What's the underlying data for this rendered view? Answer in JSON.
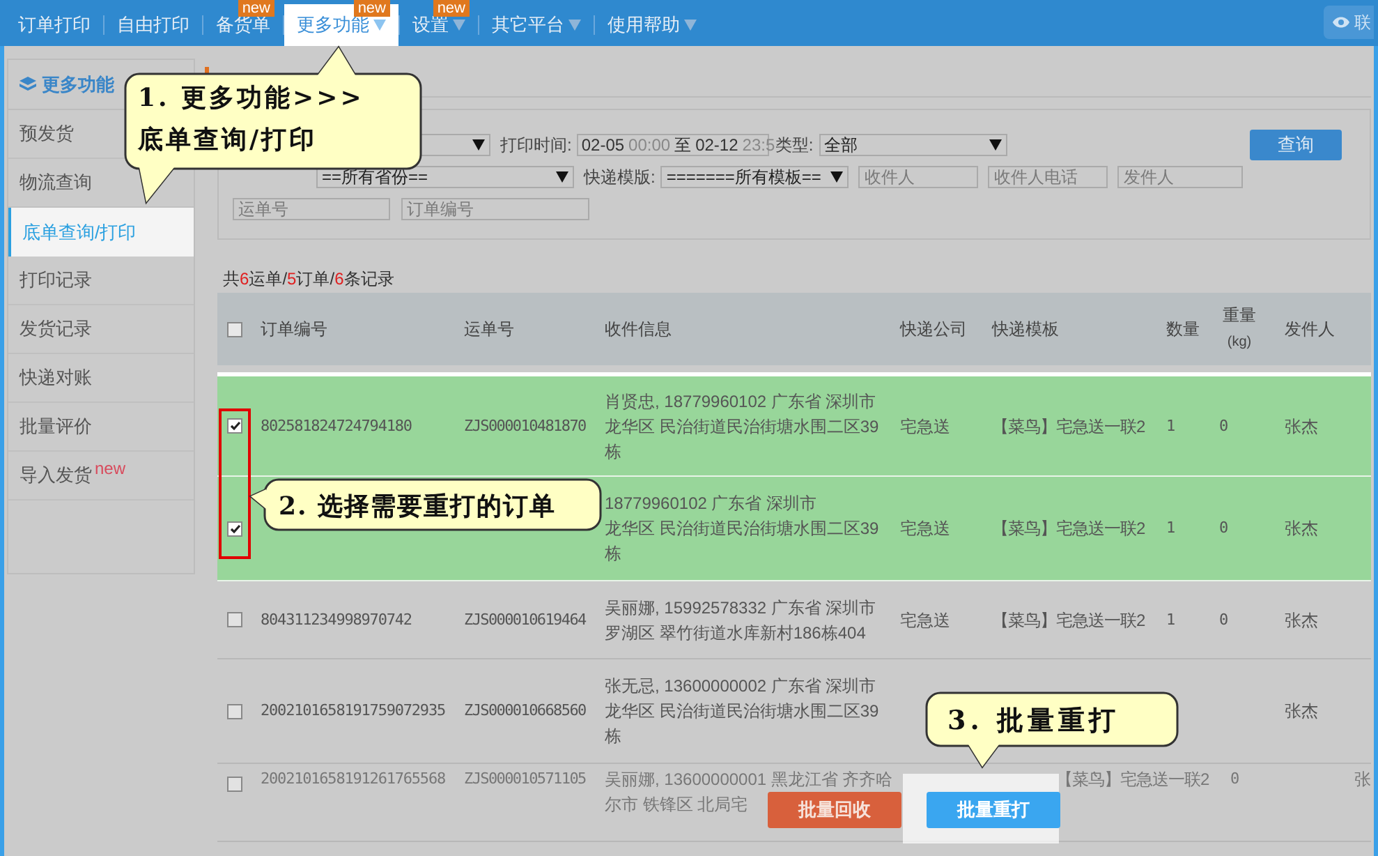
{
  "nav": {
    "tabs": [
      {
        "label": "订单打印",
        "selected": false,
        "has_menu": false
      },
      {
        "label": "自由打印",
        "selected": false,
        "has_menu": false
      },
      {
        "label": "备货单",
        "selected": false,
        "has_menu": false,
        "badge": "new"
      },
      {
        "label": "更多功能",
        "selected": true,
        "has_menu": true,
        "badge": "new"
      },
      {
        "label": "设置",
        "selected": false,
        "has_menu": true,
        "badge": "new"
      },
      {
        "label": "其它平台",
        "selected": false,
        "has_menu": true
      },
      {
        "label": "使用帮助",
        "selected": false,
        "has_menu": true
      }
    ],
    "right_button": "联"
  },
  "sidebar": {
    "title": "更多功能",
    "items": [
      {
        "label": "预发货",
        "selected": false
      },
      {
        "label": "物流查询",
        "selected": false
      },
      {
        "label": "底单查询/打印",
        "selected": true
      },
      {
        "label": "打印记录",
        "selected": false
      },
      {
        "label": "发货记录",
        "selected": false
      },
      {
        "label": "快递对账",
        "selected": false
      },
      {
        "label": "批量评价",
        "selected": false
      },
      {
        "label": "导入发货",
        "selected": false,
        "badge": "new"
      }
    ]
  },
  "filters": {
    "print_time_label": "打印时间:",
    "date_start": "02-05",
    "time_start": "00:00",
    "date_sep": "至",
    "date_end": "02-12",
    "time_end": "23:5",
    "type_label": "类型:",
    "type_value": "全部",
    "query_button": "查询",
    "province_value": "==所有省份==",
    "template_label": "快递模版:",
    "template_value": "=======所有模板==",
    "placeholders_row2": [
      "收件人",
      "收件人电话",
      "发件人"
    ],
    "placeholders_row3": [
      "运单号",
      "订单编号"
    ]
  },
  "summary": [
    {
      "text": "共",
      "highlight": false
    },
    {
      "text": "6",
      "highlight": true
    },
    {
      "text": "运单/",
      "highlight": false
    },
    {
      "text": "5",
      "highlight": true
    },
    {
      "text": "订单/",
      "highlight": false
    },
    {
      "text": "6",
      "highlight": true
    },
    {
      "text": "条记录",
      "highlight": false
    }
  ],
  "table": {
    "header_checked": false,
    "columns": [
      "订单编号",
      "运单号",
      "收件信息",
      "快递公司",
      "快递模板",
      "数量",
      "重量",
      "发件人"
    ],
    "weight_unit": "(kg)",
    "rows": [
      {
        "selected": true,
        "checked": true,
        "order": "802581824724794180",
        "waybill": "ZJS000010481870",
        "address": [
          "肖贤忠, 18779960102 广东省 深圳市",
          "龙华区 民治街道民治街塘水围二区39",
          "栋"
        ],
        "company": "宅急送",
        "template": "【菜鸟】宅急送一联2",
        "qty": "1",
        "weight": "0",
        "sender": "张杰"
      },
      {
        "selected": true,
        "checked": true,
        "address": [
          "18779960102 广东省 深圳市",
          "龙华区 民治街道民治街塘水围二区39",
          "栋"
        ],
        "company": "宅急送",
        "template": "【菜鸟】宅急送一联2",
        "qty": "1",
        "weight": "0",
        "sender": "张杰"
      },
      {
        "selected": false,
        "checked": false,
        "order": "804311234998970742",
        "waybill": "ZJS000010619464",
        "address": [
          "吴丽娜, 15992578332 广东省 深圳市",
          "罗湖区 翠竹街道水库新村186栋404"
        ],
        "company": "宅急送",
        "template": "【菜鸟】宅急送一联2",
        "qty": "1",
        "weight": "0",
        "sender": "张杰"
      },
      {
        "selected": false,
        "checked": false,
        "order": "2002101658191759072935",
        "waybill": "ZJS000010668560",
        "address": [
          "张无忌, 13600000002 广东省 深圳市",
          "龙华区 民治街道民治街塘水围二区39",
          "栋"
        ],
        "sender": "张杰"
      },
      {
        "selected": false,
        "checked": false,
        "order": "2002101658191261765568",
        "waybill": "ZJS000010571105",
        "address": [
          "吴丽娜, 13600000001 黑龙江省 齐齐哈",
          "尔市 铁锋区 北局宅"
        ],
        "template": "【菜鸟】宅急送一联2",
        "weight": "0",
        "sender": "张"
      }
    ]
  },
  "actions": [
    {
      "label": "批量回收",
      "kind": "danger"
    },
    {
      "label": "批量重打",
      "kind": "primary"
    }
  ],
  "callouts": [
    {
      "lines": [
        "1. 更多功能>>>",
        "底单查询/打印"
      ]
    },
    {
      "lines": [
        "2. 选择需要重打的订单"
      ]
    },
    {
      "lines": [
        "3. 批量重打"
      ]
    }
  ]
}
